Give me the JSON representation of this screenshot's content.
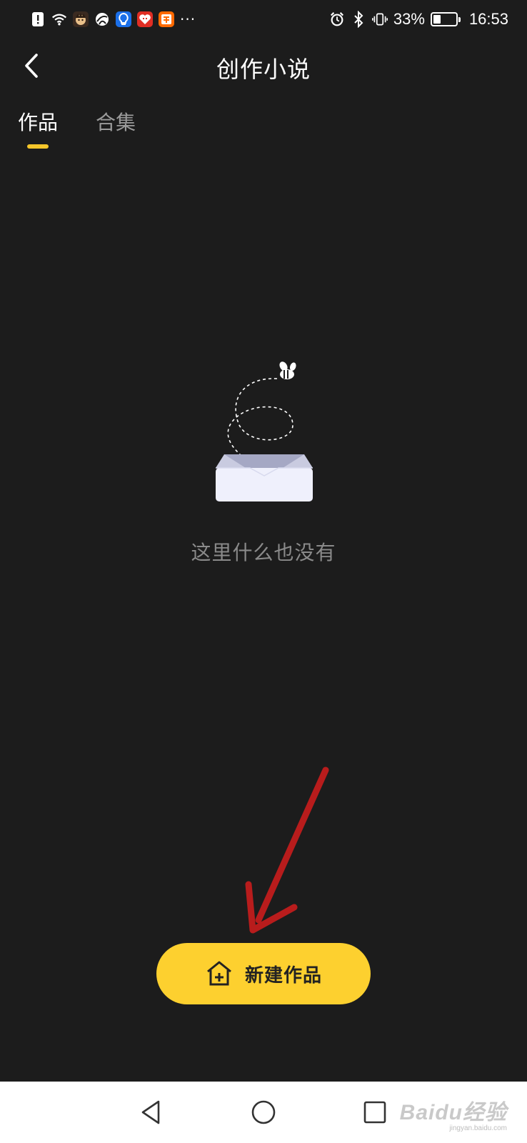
{
  "status_bar": {
    "battery_percent": "33%",
    "battery_level": 0.33,
    "time": "16:53",
    "more_indicator": "···",
    "app_icons": [
      "alert-icon",
      "wifi-icon",
      "emoji-app-icon",
      "browser-app-icon",
      "lightbulb-app-icon",
      "pinduoduo-app-icon",
      "taobao-app-icon"
    ],
    "right_icons": [
      "alarm-icon",
      "bluetooth-icon",
      "vibrate-icon",
      "battery-icon"
    ]
  },
  "header": {
    "title": "创作小说",
    "back_icon": "chevron-left-icon"
  },
  "tabs": [
    {
      "label": "作品",
      "active": true
    },
    {
      "label": "合集",
      "active": false
    }
  ],
  "empty_state": {
    "message": "这里什么也没有",
    "illustration": "empty-inbox-with-bee"
  },
  "actions": {
    "new_work_label": "新建作品",
    "new_work_icon": "house-plus-icon"
  },
  "colors": {
    "background": "#1c1c1c",
    "accent": "#fdd02f",
    "tab_indicator": "#f5c62a",
    "annotation_arrow": "#b81c1c"
  },
  "nav_bar": {
    "buttons": [
      "back-triangle-icon",
      "home-circle-icon",
      "recents-square-icon"
    ]
  },
  "watermark": {
    "main": "Baidu经验",
    "sub": "jingyan.baidu.com"
  }
}
